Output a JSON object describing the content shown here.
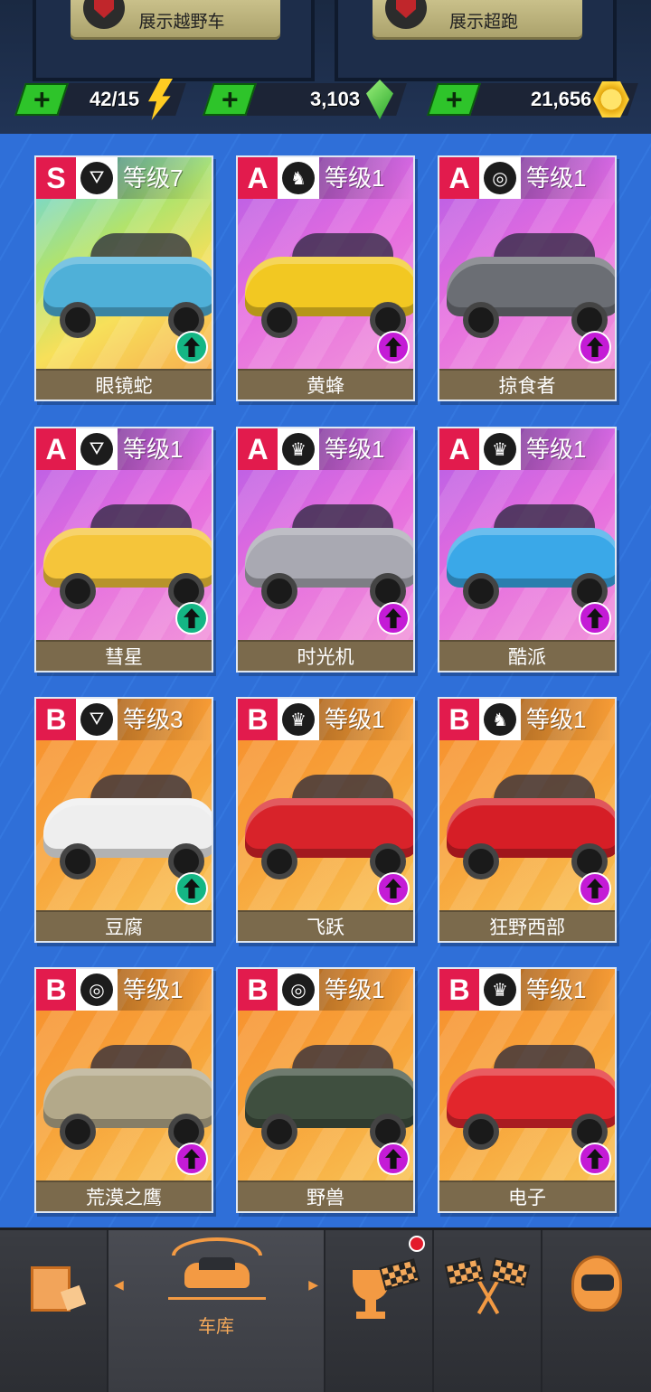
{
  "header": {
    "showcases": [
      {
        "label": "展示越野车"
      },
      {
        "label": "展示超跑"
      }
    ],
    "currencies": {
      "energy": {
        "value": "42/15",
        "icon": "lightning-bolt-icon",
        "add_label": "+"
      },
      "gems": {
        "value": "3,103",
        "icon": "green-gem-icon",
        "add_label": "+"
      },
      "coins": {
        "value": "21,656",
        "icon": "gold-coin-icon",
        "add_label": "+"
      }
    }
  },
  "garage": {
    "cars": [
      {
        "grade": "S",
        "type_icon": "road-icon",
        "level": "等级7",
        "name": "眼镜蛇",
        "color": "#4fb0d8",
        "theme": "rainbow",
        "upgrade": "green"
      },
      {
        "grade": "A",
        "type_icon": "horse-icon",
        "level": "等级1",
        "name": "黄蜂",
        "color": "#f2c822",
        "theme": "pink",
        "upgrade": "magenta"
      },
      {
        "grade": "A",
        "type_icon": "tire-icon",
        "level": "等级1",
        "name": "掠食者",
        "color": "#6b6e74",
        "theme": "pink",
        "upgrade": "magenta"
      },
      {
        "grade": "A",
        "type_icon": "road-icon",
        "level": "等级1",
        "name": "彗星",
        "color": "#f5c53a",
        "theme": "pink",
        "upgrade": "green"
      },
      {
        "grade": "A",
        "type_icon": "crown-gauge-icon",
        "level": "等级1",
        "name": "时光机",
        "color": "#a9a9b2",
        "theme": "pink",
        "upgrade": "magenta"
      },
      {
        "grade": "A",
        "type_icon": "crown-gauge-icon",
        "level": "等级1",
        "name": "酷派",
        "color": "#3aa8e8",
        "theme": "pink",
        "upgrade": "magenta"
      },
      {
        "grade": "B",
        "type_icon": "road-icon",
        "level": "等级3",
        "name": "豆腐",
        "color": "#eeeeee",
        "theme": "orange",
        "upgrade": "green"
      },
      {
        "grade": "B",
        "type_icon": "crown-gauge-icon",
        "level": "等级1",
        "name": "飞跃",
        "color": "#d8232a",
        "theme": "orange",
        "upgrade": "magenta"
      },
      {
        "grade": "B",
        "type_icon": "horse-icon",
        "level": "等级1",
        "name": "狂野西部",
        "color": "#d61e26",
        "theme": "orange",
        "upgrade": "magenta"
      },
      {
        "grade": "B",
        "type_icon": "tire-icon",
        "level": "等级1",
        "name": "荒漠之鹰",
        "color": "#b3a98a",
        "theme": "orange",
        "upgrade": "magenta"
      },
      {
        "grade": "B",
        "type_icon": "tire-icon",
        "level": "等级1",
        "name": "野兽",
        "color": "#3f4f3f",
        "theme": "orange",
        "upgrade": "magenta"
      },
      {
        "grade": "B",
        "type_icon": "crown-gauge-icon",
        "level": "等级1",
        "name": "电子",
        "color": "#e2262c",
        "theme": "orange",
        "upgrade": "magenta"
      }
    ]
  },
  "nav": {
    "items": [
      {
        "name": "shop",
        "icon": "parcel-box-icon"
      },
      {
        "name": "garage",
        "icon": "garage-car-icon",
        "label": "车库",
        "selected": true
      },
      {
        "name": "events",
        "icon": "trophy-flag-icon",
        "has_notification": true
      },
      {
        "name": "race",
        "icon": "checkered-flags-icon"
      },
      {
        "name": "profile",
        "icon": "racing-helmet-icon"
      }
    ]
  }
}
